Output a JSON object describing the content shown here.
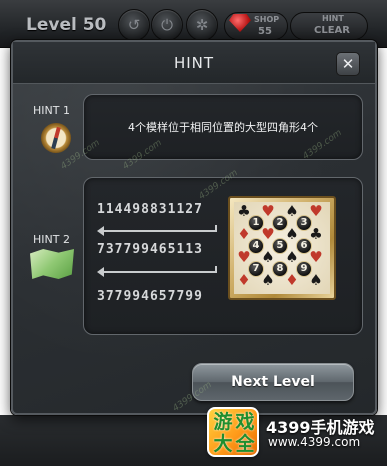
{
  "topbar": {
    "level_text": "Level 50",
    "shop_label": "SHOP",
    "shop_count": "55",
    "hint_label": "HINT",
    "clear_label": "CLEAR"
  },
  "dialog": {
    "title": "HINT",
    "close_label": "✕",
    "hint1": {
      "label": "HINT 1",
      "text": "4个模样位于相同位置的大型四角形4个",
      "icon": "compass-icon"
    },
    "hint2": {
      "label": "HINT 2",
      "icon": "map-icon",
      "sequences": [
        "114498831127",
        "737799465113",
        "377994657799"
      ],
      "board": {
        "suits": [
          [
            "♣",
            "♥",
            "♠",
            "♥"
          ],
          [
            "♦",
            "♥",
            "♠",
            "♣"
          ],
          [
            "♥",
            "♠",
            "♠",
            "♥"
          ],
          [
            "♦",
            "♠",
            "♦",
            "♠"
          ]
        ],
        "nodes": [
          "1",
          "2",
          "3",
          "4",
          "5",
          "6",
          "7",
          "8",
          "9"
        ]
      }
    },
    "next_button": "Next Level"
  },
  "watermark": {
    "logo_chars": [
      "游",
      "戏",
      "大",
      "全"
    ],
    "brand": "4399手机游戏",
    "url": "www.4399.com",
    "tag": "4399.com"
  },
  "colors": {
    "dialog_bg": "#2b2f33",
    "panel_border": "#62676c",
    "button": "#5f676d",
    "heart": "#c0392b",
    "spade": "#1a1a1a"
  }
}
